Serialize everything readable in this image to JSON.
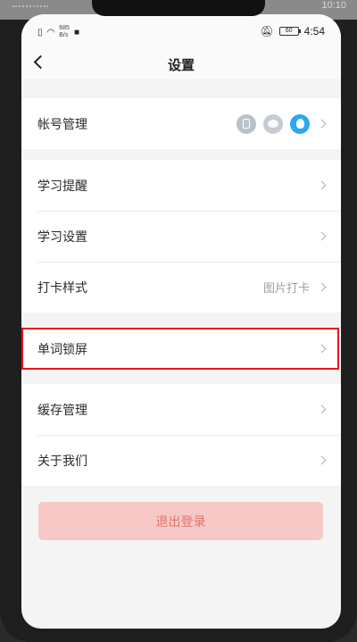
{
  "device": {
    "top_clock": "10:10"
  },
  "status_bar": {
    "net_speed_value": "685",
    "net_speed_unit": "B/s",
    "battery": "60",
    "time": "4:54"
  },
  "header": {
    "title": "设置"
  },
  "settings": {
    "account": {
      "label": "帐号管理",
      "icons": [
        "phone-icon",
        "wechat-icon",
        "qq-icon"
      ]
    },
    "group1": [
      {
        "label": "学习提醒",
        "value": ""
      },
      {
        "label": "学习设置",
        "value": ""
      },
      {
        "label": "打卡样式",
        "value": "图片打卡"
      }
    ],
    "lockscreen": {
      "label": "单词锁屏"
    },
    "group2": [
      {
        "label": "缓存管理"
      },
      {
        "label": "关于我们"
      }
    ]
  },
  "logout_label": "退出登录",
  "colors": {
    "highlight": "#e8141c",
    "logout_bg": "#f6c9c6",
    "logout_text": "#e3736b",
    "qq_blue": "#2aa8f2"
  }
}
